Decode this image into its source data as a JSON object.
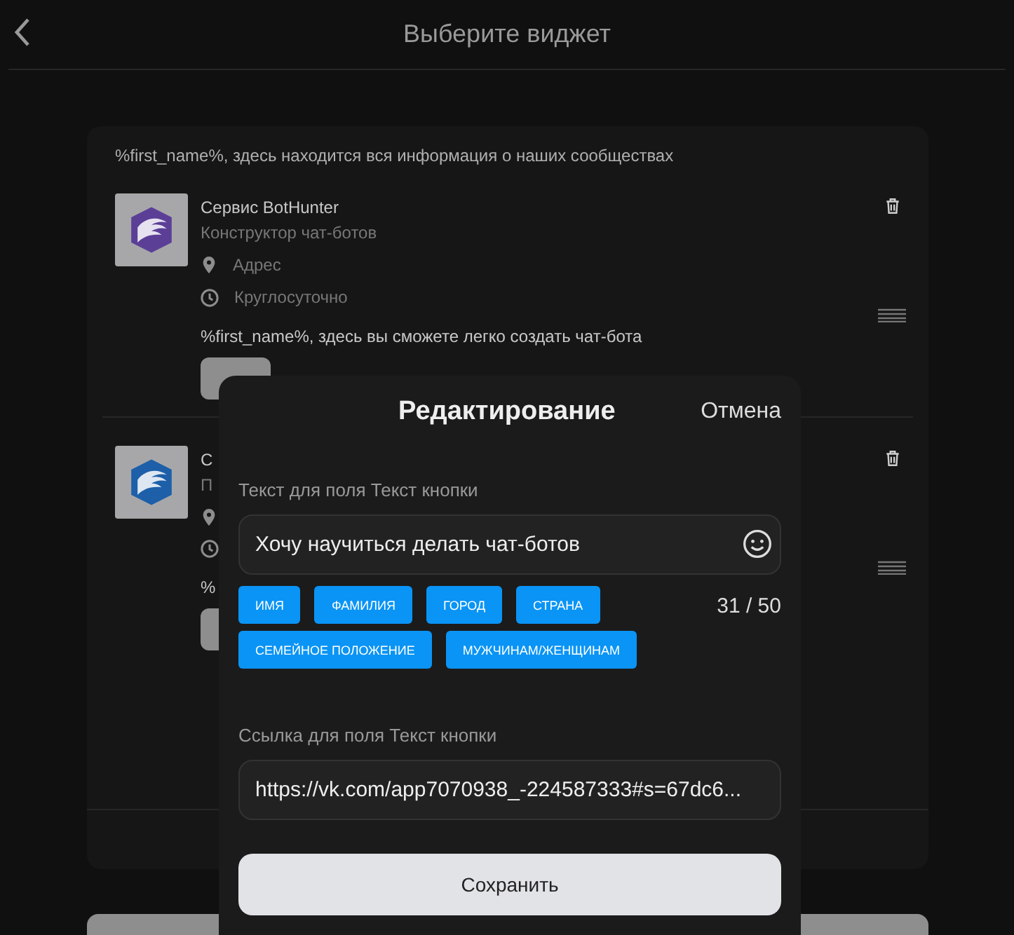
{
  "header": {
    "title": "Выберите виджет"
  },
  "card": {
    "heading": "%first_name%, здесь находится вся информация о наших сообществах",
    "items": [
      {
        "title": "Сервис BotHunter",
        "subtitle": "Конструктор чат-ботов",
        "address": "Адрес",
        "hours": "Круглосуточно",
        "description": "%first_name%, здесь вы сможете легко создать чат-бота",
        "color": "#5b3f97"
      },
      {
        "title": "С",
        "subtitle": "П",
        "description": "%",
        "color": "#1d5fa8"
      }
    ]
  },
  "modal": {
    "title": "Редактирование",
    "cancel": "Отмена",
    "text_label": "Текст для поля Текст кнопки",
    "text_value": "Хочу научиться делать чат-ботов",
    "chips": [
      "ИМЯ",
      "ФАМИЛИЯ",
      "ГОРОД",
      "СТРАНА",
      "СЕМЕЙНОЕ ПОЛОЖЕНИЕ",
      "МУЖЧИНАМ/ЖЕНЩИНАМ"
    ],
    "counter": "31 / 50",
    "link_label": "Ссылка для поля Текст кнопки",
    "link_value": "https://vk.com/app7070938_-224587333#s=67dc6...",
    "save": "Сохранить"
  }
}
